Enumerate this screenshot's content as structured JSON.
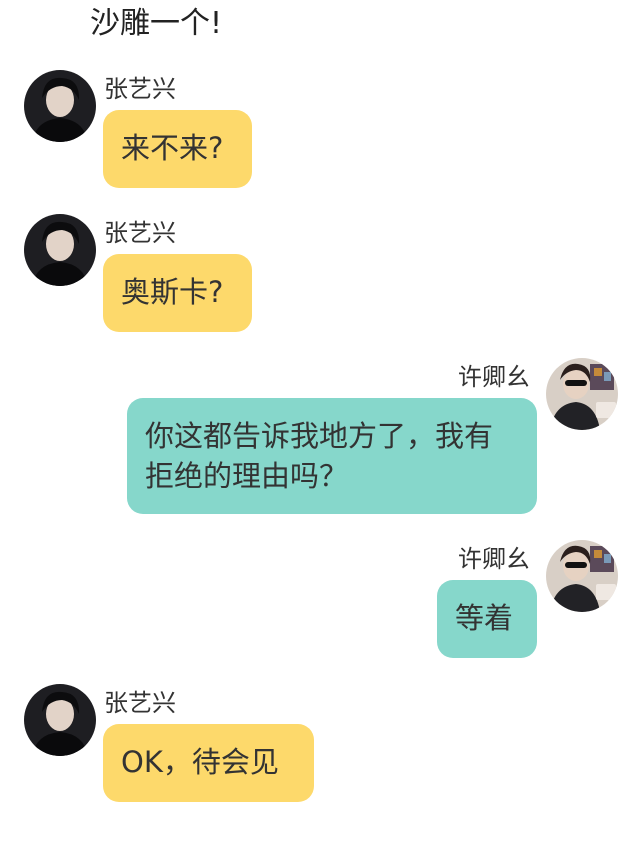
{
  "chat": {
    "top_text": "沙雕一个!",
    "messages": [
      {
        "sender": "张艺兴",
        "side": "left",
        "text": "来不来?"
      },
      {
        "sender": "张艺兴",
        "side": "left",
        "text": "奥斯卡?"
      },
      {
        "sender": "许卿幺",
        "side": "right",
        "text": "你这都告诉我地方了，我有拒绝的理由吗？"
      },
      {
        "sender": "许卿幺",
        "side": "right",
        "text": "等着"
      },
      {
        "sender": "张艺兴",
        "side": "left",
        "text": "OK，待会见"
      }
    ]
  },
  "colors": {
    "left_bubble": "#fdd96b",
    "right_bubble": "#86d7cb"
  }
}
